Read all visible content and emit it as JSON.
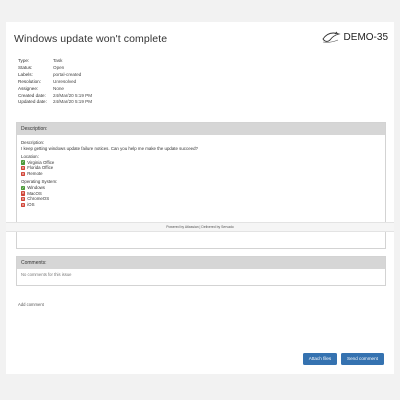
{
  "header": {
    "title": "Windows update won't complete",
    "issue_key": "DEMO-35",
    "logo_icon": "bird-logo-icon"
  },
  "fields": [
    {
      "label": "Type:",
      "value": "Task"
    },
    {
      "label": "Status:",
      "value": "Open"
    },
    {
      "label": "Labels:",
      "value": "portal-created"
    },
    {
      "label": "Resolution:",
      "value": "Unresolved"
    },
    {
      "label": "Assignee:",
      "value": "None"
    },
    {
      "label": "Created date:",
      "value": "24/Mar/20 5:19 PM"
    },
    {
      "label": "Updated date:",
      "value": "24/Mar/20 5:19 PM"
    }
  ],
  "description": {
    "header": "Description:",
    "label": "Description:",
    "text": "I keep getting windows update failure notices. Can you help me make the update succeed?",
    "location_label": "Location:",
    "locations": [
      {
        "label": "Virginia Office",
        "checked": true
      },
      {
        "label": "Florida Office",
        "checked": false
      },
      {
        "label": "Remote",
        "checked": false
      }
    ],
    "os_label": "Operating System:",
    "os": [
      {
        "label": "Windows",
        "checked": true
      },
      {
        "label": "MacOS",
        "checked": false
      },
      {
        "label": "ChromeOS",
        "checked": false
      },
      {
        "label": "iOS",
        "checked": false
      }
    ]
  },
  "footer_text": "Powered by Atlassian | Delivered by Servado",
  "comments": {
    "header": "Comments:",
    "empty_text": "No comments for this issue"
  },
  "add_comment_label": "Add comment",
  "buttons": {
    "attach": "Attach files",
    "send": "Send comment"
  },
  "colors": {
    "primary_button": "#3572b0",
    "checked": "#4c9a3a",
    "unchecked": "#d04437",
    "panel_header": "#d6d6d6"
  }
}
